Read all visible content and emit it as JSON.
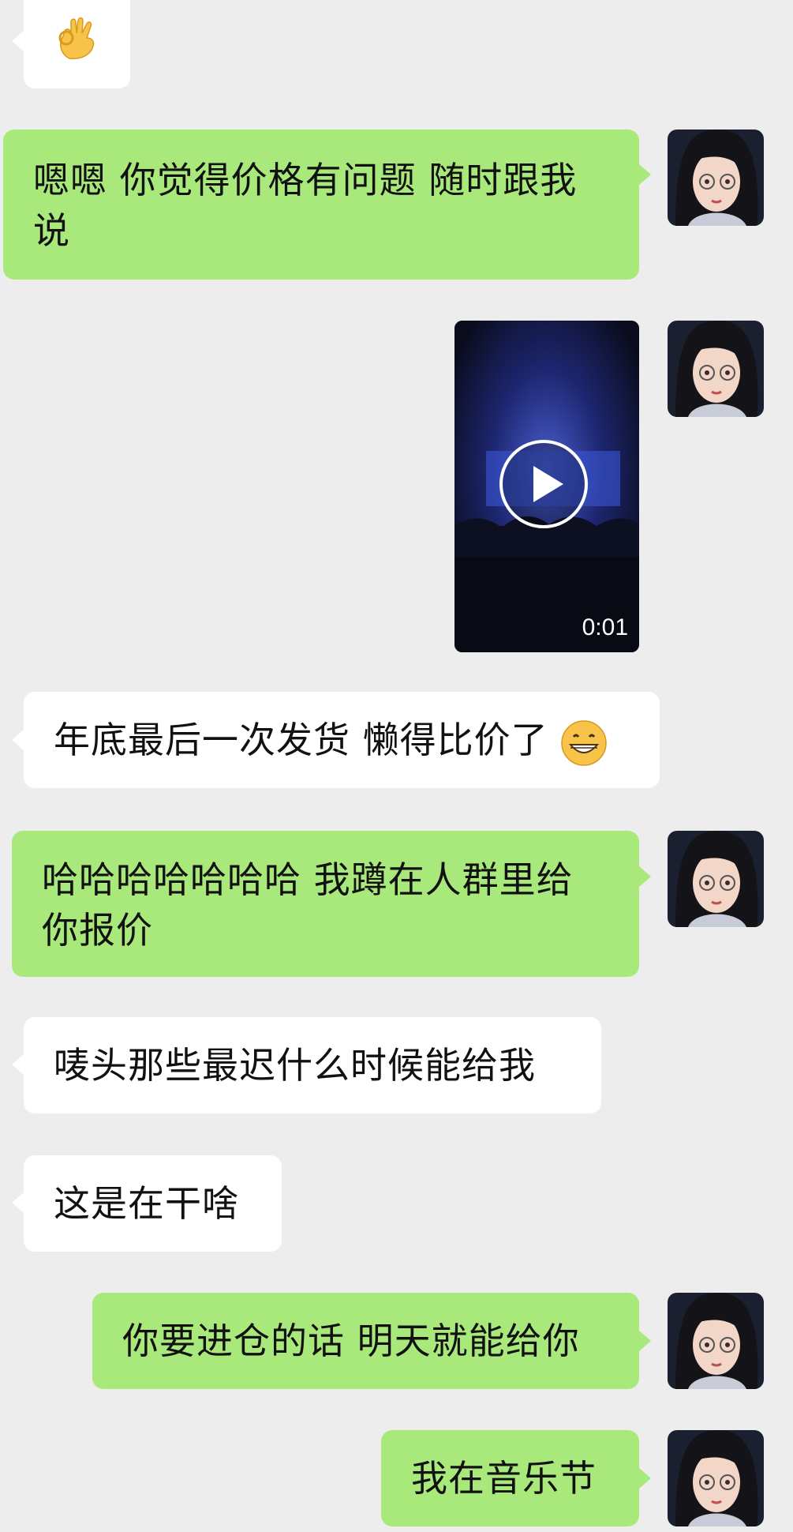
{
  "messages": [
    {
      "id": "m0",
      "side": "in",
      "type": "emoji",
      "icon": "ok-hand-emoji"
    },
    {
      "id": "m1",
      "side": "out",
      "type": "text",
      "lines": [
        "嗯嗯 你觉得价格有问题 随时跟我",
        "说"
      ]
    },
    {
      "id": "m2",
      "side": "out",
      "type": "video",
      "duration": "0:01"
    },
    {
      "id": "m3",
      "side": "in",
      "type": "text",
      "text": "年底最后一次发货 懒得比价了",
      "emoji": "grinning-face-emoji"
    },
    {
      "id": "m4",
      "side": "out",
      "type": "text",
      "lines": [
        "哈哈哈哈哈哈哈 我蹲在人群里给",
        "你报价"
      ]
    },
    {
      "id": "m5",
      "side": "in",
      "type": "text",
      "text": "唛头那些最迟什么时候能给我"
    },
    {
      "id": "m6",
      "side": "in",
      "type": "text",
      "text": "这是在干啥"
    },
    {
      "id": "m7",
      "side": "out",
      "type": "text",
      "text": "你要进仓的话 明天就能给你"
    },
    {
      "id": "m8",
      "side": "out",
      "type": "text",
      "text": "我在音乐节"
    }
  ],
  "colors": {
    "background": "#ededed",
    "incoming_bubble": "#ffffff",
    "outgoing_bubble": "#a9e97b",
    "text": "#111111"
  }
}
